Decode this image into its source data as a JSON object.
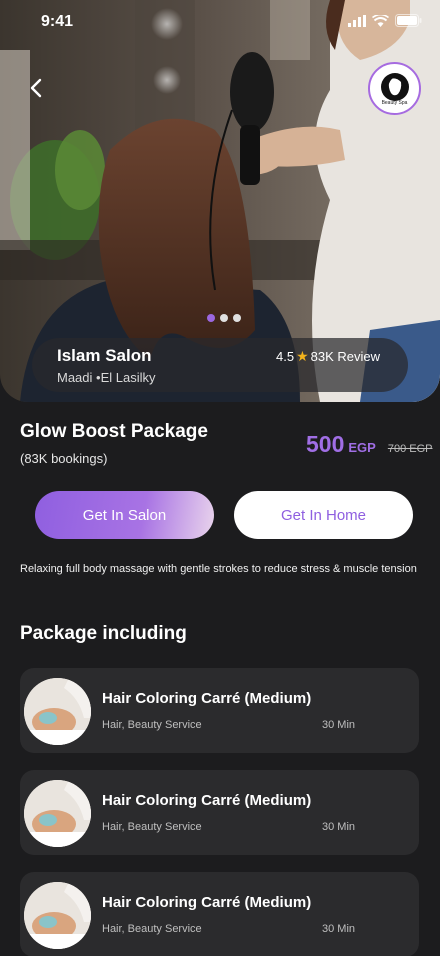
{
  "status_bar": {
    "time": "9:41"
  },
  "brand": {
    "logo_text": "Beauty Spa"
  },
  "salon": {
    "name": "Islam Salon",
    "location": "Maadi •El Lasilky",
    "rating": "4.5",
    "reviews": "83K Review"
  },
  "carousel": {
    "count": 3,
    "active": 1
  },
  "package": {
    "title": "Glow Boost Package",
    "bookings": "(83K bookings)",
    "price": "500",
    "currency": "EGP",
    "old_price": "700 EGP",
    "description": "Relaxing full body massage with gentle strokes to reduce stress & muscle tension"
  },
  "actions": {
    "salon_label": "Get In Salon",
    "home_label": "Get In Home"
  },
  "section": {
    "title": "Package including"
  },
  "services": [
    {
      "name": "Hair Coloring Carré (Medium)",
      "category": "Hair, Beauty Service",
      "duration": "30 Min"
    },
    {
      "name": "Hair Coloring Carré (Medium)",
      "category": "Hair, Beauty Service",
      "duration": "30 Min"
    },
    {
      "name": "Hair Coloring Carré (Medium)",
      "category": "Hair, Beauty Service",
      "duration": "30 Min"
    }
  ],
  "colors": {
    "accent": "#9b67e0",
    "background": "#1c1c1e",
    "card": "#2b2b2d",
    "star": "#f2b21c"
  },
  "icons": [
    "back-arrow-icon",
    "signal-icon",
    "wifi-icon",
    "battery-icon",
    "star-icon"
  ]
}
